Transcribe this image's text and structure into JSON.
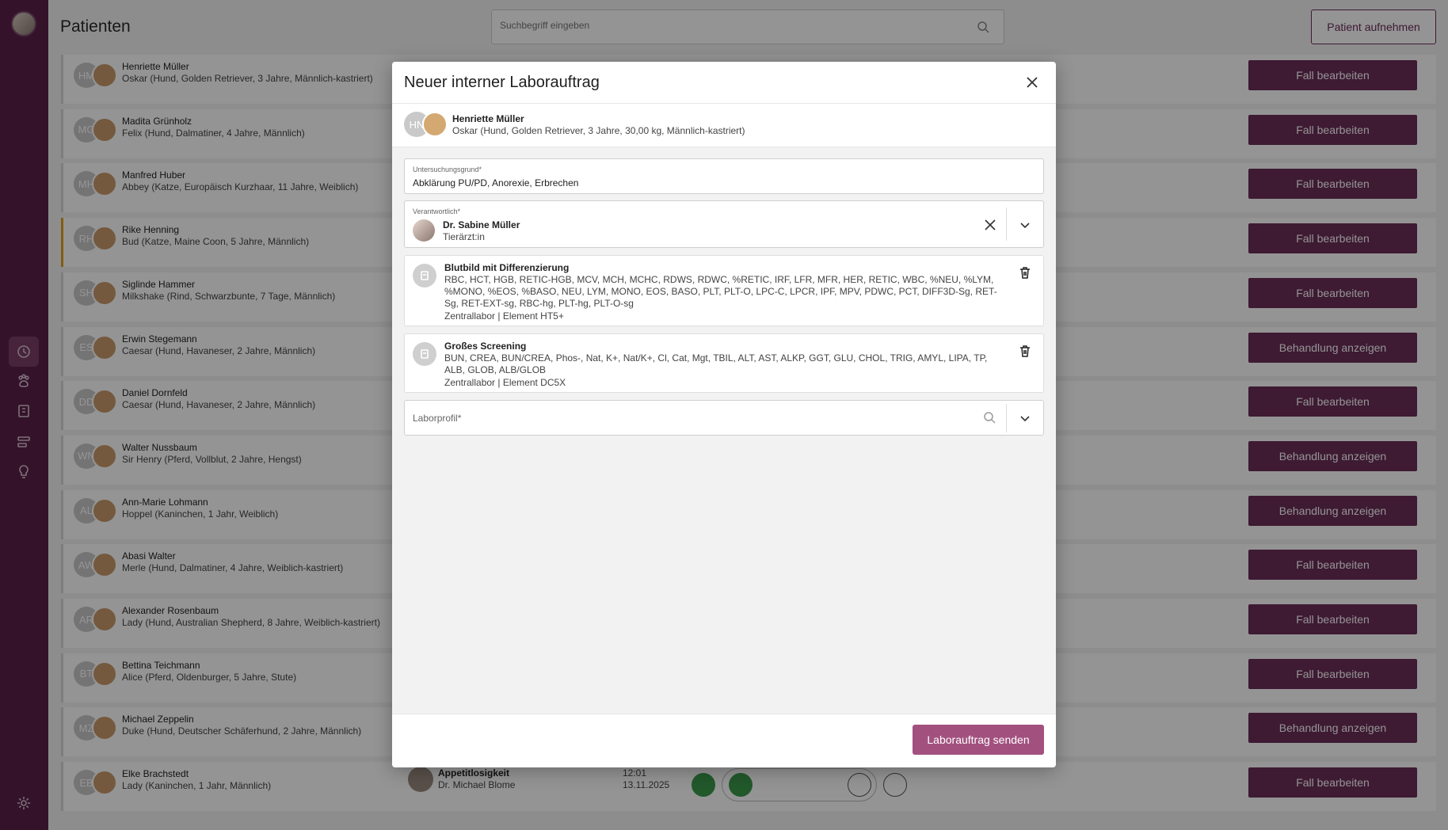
{
  "header": {
    "title": "Patienten",
    "search_placeholder": "Suchbegriff eingeben",
    "admit_button": "Patient aufnehmen"
  },
  "sidebar": {
    "icons": [
      "user-avatar",
      "timeline-icon",
      "paw-icon",
      "lab-icon",
      "workflow-icon",
      "lightbulb-icon",
      "gear-icon"
    ],
    "active": "timeline-icon"
  },
  "patients": [
    {
      "initials": "HM",
      "owner": "Henriette Müller",
      "pet": "Oskar (Hund, Golden Retriever, 3 Jahre, Männlich-kastriert)",
      "action": "Fall bearbeiten"
    },
    {
      "initials": "MG",
      "owner": "Madita Grünholz",
      "pet": "Felix (Hund, Dalmatiner, 4 Jahre, Männlich)",
      "action": "Fall bearbeiten"
    },
    {
      "initials": "MH",
      "owner": "Manfred Huber",
      "pet": "Abbey (Katze, Europäisch Kurzhaar, 11 Jahre, Weiblich)",
      "action": "Fall bearbeiten"
    },
    {
      "initials": "RH",
      "owner": "Rike Henning",
      "pet": "Bud (Katze, Maine Coon, 5 Jahre, Männlich)",
      "action": "Fall bearbeiten",
      "flag": true
    },
    {
      "initials": "SH",
      "owner": "Siglinde Hammer",
      "pet": "Milkshake (Rind, Schwarzbunte, 7 Tage, Männlich)",
      "action": "Fall bearbeiten"
    },
    {
      "initials": "ES",
      "owner": "Erwin Stegemann",
      "pet": "Caesar (Hund, Havaneser, 2 Jahre, Männlich)",
      "action": "Behandlung anzeigen"
    },
    {
      "initials": "DD",
      "owner": "Daniel Dornfeld",
      "pet": "Caesar (Hund, Havaneser, 2 Jahre, Männlich)",
      "action": "Fall bearbeiten"
    },
    {
      "initials": "WN",
      "owner": "Walter Nussbaum",
      "pet": "Sir Henry (Pferd, Vollblut, 2 Jahre, Hengst)",
      "action": "Behandlung anzeigen"
    },
    {
      "initials": "AL",
      "owner": "Ann-Marie Lohmann",
      "pet": "Hoppel (Kaninchen, 1 Jahr, Weiblich)",
      "action": "Behandlung anzeigen"
    },
    {
      "initials": "AW",
      "owner": "Abasi Walter",
      "pet": "Merle (Hund, Dalmatiner, 4 Jahre, Weiblich-kastriert)",
      "action": "Fall bearbeiten"
    },
    {
      "initials": "AR",
      "owner": "Alexander Rosenbaum",
      "pet": "Lady (Hund, Australian Shepherd, 8 Jahre, Weiblich-kastriert)",
      "action": "Fall bearbeiten"
    },
    {
      "initials": "BT",
      "owner": "Bettina Teichmann",
      "pet": "Alice (Pferd, Oldenburger, 5 Jahre, Stute)",
      "action": "Fall bearbeiten"
    },
    {
      "initials": "MZ",
      "owner": "Michael Zeppelin",
      "pet": "Duke (Hund, Deutscher Schäferhund, 2 Jahre, Männlich)",
      "action": "Behandlung anzeigen"
    },
    {
      "initials": "EB",
      "owner": "Elke Brachstedt",
      "pet": "Lady (Kaninchen, 1 Jahr, Männlich)",
      "action": "Fall bearbeiten"
    }
  ],
  "last_row_extra": {
    "reason": "Appetitlosigkeit",
    "vet": "Dr. Michael Blome",
    "time": "12:01",
    "date": "13.11.2025"
  },
  "modal": {
    "title": "Neuer interner Laborauftrag",
    "patient": {
      "initials": "HN",
      "owner": "Henriette Müller",
      "pet": "Oskar (Hund, Golden Retriever, 3 Jahre, 30,00 kg, Männlich-kastriert)"
    },
    "reason_label": "Untersuchungsgrund*",
    "reason_value": "Abklärung PU/PD, Anorexie, Erbrechen",
    "responsible_label": "Verantwortlich*",
    "responsible_name": "Dr. Sabine Müller",
    "responsible_role": "Tierärzt:in",
    "labs": [
      {
        "name": "Blutbild mit Differenzierung",
        "params": "RBC, HCT, HGB, RETIC-HGB, MCV, MCH, MCHC, RDWS, RDWC, %RETIC, IRF, LFR, MFR, HER, RETIC, WBC, %NEU, %LYM, %MONO, %EOS, %BASO, NEU, LYM, MONO, EOS, BASO, PLT, PLT-O, LPC-C, LPCR, IPF, MPV, PDWC, PCT, DIFF3D-Sg, RET-Sg, RET-EXT-sg, RBC-hg, PLT-hg, PLT-O-sg",
        "device": "Zentrallabor | Element HT5+"
      },
      {
        "name": "Großes Screening",
        "params": "BUN, CREA, BUN/CREA, Phos-, Nat, K+, Nat/K+, Cl, Cat, Mgt, TBIL, ALT, AST, ALKP, GGT, GLU, CHOL, TRIG, AMYL, LIPA, TP, ALB, GLOB, ALB/GLOB",
        "device": "Zentrallabor | Element DC5X"
      }
    ],
    "profile_label": "Laborprofil*",
    "send_button": "Laborauftrag senden"
  }
}
